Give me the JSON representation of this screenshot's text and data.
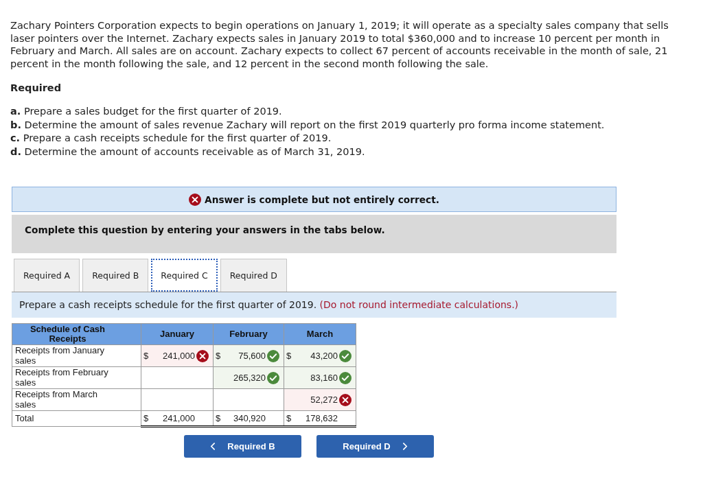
{
  "problem": {
    "paragraph": "Zachary Pointers Corporation expects to begin operations on January 1, 2019; it will operate as a specialty sales company that sells laser pointers over the Internet. Zachary expects sales in January 2019 to total $360,000 and to increase 10 percent per month in February and March. All sales are on account. Zachary expects to collect 67 percent of accounts receivable in the month of sale, 21 percent in the month following the sale, and 12 percent in the second month following the sale.",
    "required_heading": "Required",
    "parts": [
      "**a.** Prepare a sales budget for the first quarter of 2019.",
      "**b.** Determine the amount of sales revenue Zachary will report on the first 2019 quarterly pro forma income statement.",
      "**c.** Prepare a cash receipts schedule for the first quarter of 2019.",
      "**d.** Determine the amount of accounts receivable as of March 31, 2019."
    ]
  },
  "answer_banner": {
    "correct": false,
    "text": "Answer is complete but not entirely correct."
  },
  "instructions": "Complete this question by entering your answers in the tabs below.",
  "tabs": [
    {
      "label": "Required A",
      "selected": false
    },
    {
      "label": "Required B",
      "selected": false
    },
    {
      "label": "Required C",
      "selected": true
    },
    {
      "label": "Required D",
      "selected": false
    }
  ],
  "prompt": {
    "text": "Prepare a cash receipts schedule for the first quarter of 2019.",
    "note": "(Do not round intermediate calculations.)"
  },
  "table": {
    "columns": [
      "Schedule of Cash Receipts",
      "January",
      "February",
      "March"
    ],
    "rows": [
      {
        "kind": "entry",
        "cells": [
          {
            "text": "Receipts from January sales"
          },
          {
            "currency": "$",
            "value": "241,000",
            "correct": false
          },
          {
            "currency": "$",
            "value": "75,600",
            "correct": true
          },
          {
            "currency": "$",
            "value": "43,200",
            "correct": true
          }
        ]
      },
      {
        "kind": "entry",
        "cells": [
          {
            "text": "Receipts from February sales"
          },
          "",
          {
            "value": "265,320",
            "correct": true
          },
          {
            "value": "83,160",
            "correct": true
          }
        ]
      },
      {
        "kind": "entry",
        "cells": [
          {
            "text": "Receipts from March sales"
          },
          "",
          "",
          {
            "value": "52,272",
            "correct": false
          }
        ]
      },
      {
        "kind": "total",
        "cells": [
          {
            "text": "Total"
          },
          {
            "currency": "$",
            "value": "241,000"
          },
          {
            "currency": "$",
            "value": "340,920"
          },
          {
            "currency": "$",
            "value": "178,632"
          }
        ]
      }
    ]
  },
  "nav_buttons": [
    {
      "kind": "previous",
      "label": "Required B"
    },
    {
      "kind": "next",
      "label": "Required D"
    }
  ]
}
